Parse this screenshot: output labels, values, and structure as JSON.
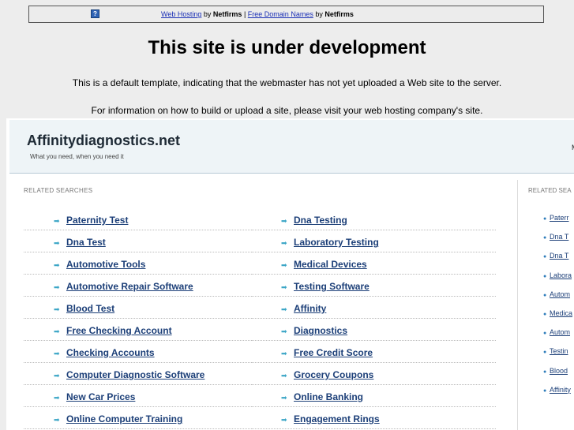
{
  "topbar": {
    "link1": "Web Hosting",
    "by": "by",
    "brand": "Netfirms",
    "separator": "|",
    "link2": "Free Domain Names"
  },
  "page": {
    "title": "This site is under development",
    "line1": "This is a default template, indicating that the webmaster has not yet uploaded a Web site to the server.",
    "line2": "For information on how to build or upload a site, please visit your web hosting company's site."
  },
  "site": {
    "name": "Affinitydiagnostics.net",
    "tagline": "What you need, when you need it",
    "header_cut": "M"
  },
  "related": {
    "label": "RELATED SEARCHES",
    "left": [
      "Paternity Test",
      "Dna Test",
      "Automotive Tools",
      "Automotive Repair Software",
      "Blood Test",
      "Free Checking Account",
      "Checking Accounts",
      "Computer Diagnostic Software",
      "New Car Prices",
      "Online Computer Training"
    ],
    "right": [
      "Dna Testing",
      "Laboratory Testing",
      "Medical Devices",
      "Testing Software",
      "Affinity",
      "Diagnostics",
      "Free Credit Score",
      "Grocery Coupons",
      "Online Banking",
      "Engagement Rings"
    ]
  },
  "sidebar": {
    "label": "RELATED SEA",
    "items": [
      "Paterr",
      "Dna T",
      "Dna T",
      "Labora",
      "Autom",
      "Medica",
      "Autom",
      "Testin",
      "Blood",
      "Affinity"
    ]
  }
}
